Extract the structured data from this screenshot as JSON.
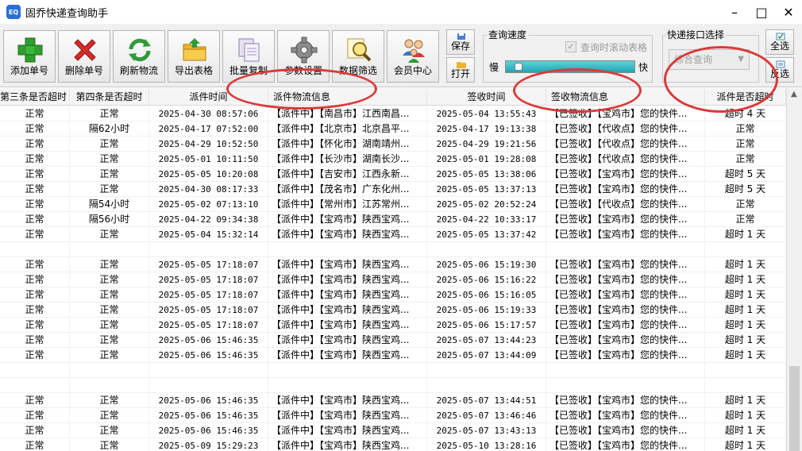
{
  "window": {
    "title": "固乔快递查询助手",
    "icon_text": "EQ"
  },
  "toolbar": {
    "buttons": [
      {
        "label": "添加单号",
        "icon": "plus-icon"
      },
      {
        "label": "删除单号",
        "icon": "delete-x-icon"
      },
      {
        "label": "刷新物流",
        "icon": "refresh-icon"
      },
      {
        "label": "导出表格",
        "icon": "folder-export-icon"
      },
      {
        "label": "批量复制",
        "icon": "copy-icon"
      },
      {
        "label": "参数设置",
        "icon": "gear-icon"
      },
      {
        "label": "数据筛选",
        "icon": "magnifier-icon"
      },
      {
        "label": "会员中心",
        "icon": "users-icon"
      }
    ],
    "save_label": "保存",
    "open_label": "打开",
    "speed_group": {
      "title": "查询速度",
      "scroll_label": "查询时滚动表格",
      "scroll_checked": true,
      "slow": "慢",
      "fast": "快",
      "speed_level": 0.05
    },
    "interface_group": {
      "title": "快递接口选择",
      "selected": "综合查询"
    },
    "select_all_label": "全选",
    "invert_label": "反选"
  },
  "table": {
    "columns": [
      "第三条是否超时",
      "第四条是否超时",
      "派件时间",
      "派件物流信息",
      "签收时间",
      "签收物流信息",
      "派件是否超时"
    ],
    "rows": [
      [
        "正常",
        "正常",
        "2025-04-30 08:57:06",
        "【派件中】【南昌市】江西南昌...",
        "2025-05-04 13:55:43",
        "【已签收】【宝鸡市】您的快件...",
        "超时 4 天"
      ],
      [
        "正常",
        "隔62小时",
        "2025-04-17 07:52:00",
        "【派件中】【北京市】北京昌平...",
        "2025-04-17 19:13:38",
        "【已签收】【代收点】您的快件...",
        "正常"
      ],
      [
        "正常",
        "正常",
        "2025-04-29 10:52:50",
        "【派件中】【怀化市】湖南靖州...",
        "2025-04-29 19:21:56",
        "【已签收】【代收点】您的快件...",
        "正常"
      ],
      [
        "正常",
        "正常",
        "2025-05-01 10:11:50",
        "【派件中】【长沙市】湖南长沙...",
        "2025-05-01 19:28:08",
        "【已签收】【代收点】您的快件...",
        "正常"
      ],
      [
        "正常",
        "正常",
        "2025-05-05 10:20:08",
        "【派件中】【吉安市】江西永新...",
        "2025-05-05 13:38:06",
        "【已签收】【宝鸡市】您的快件...",
        "超时 5 天"
      ],
      [
        "正常",
        "正常",
        "2025-04-30 08:17:33",
        "【派件中】【茂名市】广东化州...",
        "2025-05-05 13:37:13",
        "【已签收】【宝鸡市】您的快件...",
        "超时 5 天"
      ],
      [
        "正常",
        "隔54小时",
        "2025-05-02 07:13:10",
        "【派件中】【常州市】江苏常州...",
        "2025-05-02 20:52:24",
        "【已签收】【代收点】您的快件...",
        "正常"
      ],
      [
        "正常",
        "隔56小时",
        "2025-04-22 09:34:38",
        "【派件中】【宝鸡市】陕西宝鸡...",
        "2025-04-22 10:33:17",
        "【已签收】【宝鸡市】您的快件...",
        "正常"
      ],
      [
        "正常",
        "正常",
        "2025-05-04 15:32:14",
        "【派件中】【宝鸡市】陕西宝鸡...",
        "2025-05-05 13:37:42",
        "【已签收】【宝鸡市】您的快件...",
        "超时 1 天"
      ],
      [
        "",
        "",
        "",
        "",
        "",
        "",
        ""
      ],
      [
        "正常",
        "正常",
        "2025-05-05 17:18:07",
        "【派件中】【宝鸡市】陕西宝鸡...",
        "2025-05-06 15:19:30",
        "【已签收】【宝鸡市】您的快件...",
        "超时 1 天"
      ],
      [
        "正常",
        "正常",
        "2025-05-05 17:18:07",
        "【派件中】【宝鸡市】陕西宝鸡...",
        "2025-05-06 15:16:22",
        "【已签收】【宝鸡市】您的快件...",
        "超时 1 天"
      ],
      [
        "正常",
        "正常",
        "2025-05-05 17:18:07",
        "【派件中】【宝鸡市】陕西宝鸡...",
        "2025-05-06 15:16:05",
        "【已签收】【宝鸡市】您的快件...",
        "超时 1 天"
      ],
      [
        "正常",
        "正常",
        "2025-05-05 17:18:07",
        "【派件中】【宝鸡市】陕西宝鸡...",
        "2025-05-06 15:19:33",
        "【已签收】【宝鸡市】您的快件...",
        "超时 1 天"
      ],
      [
        "正常",
        "正常",
        "2025-05-05 17:18:07",
        "【派件中】【宝鸡市】陕西宝鸡...",
        "2025-05-06 15:17:57",
        "【已签收】【宝鸡市】您的快件...",
        "超时 1 天"
      ],
      [
        "正常",
        "正常",
        "2025-05-06 15:46:35",
        "【派件中】【宝鸡市】陕西宝鸡...",
        "2025-05-07 13:44:23",
        "【已签收】【宝鸡市】您的快件...",
        "超时 1 天"
      ],
      [
        "正常",
        "正常",
        "2025-05-06 15:46:35",
        "【派件中】【宝鸡市】陕西宝鸡...",
        "2025-05-07 13:44:09",
        "【已签收】【宝鸡市】您的快件...",
        "超时 1 天"
      ],
      [
        "",
        "",
        "",
        "",
        "",
        "",
        ""
      ],
      [
        "",
        "",
        "",
        "",
        "",
        "",
        ""
      ],
      [
        "正常",
        "正常",
        "2025-05-06 15:46:35",
        "【派件中】【宝鸡市】陕西宝鸡...",
        "2025-05-07 13:44:51",
        "【已签收】【宝鸡市】您的快件...",
        "超时 1 天"
      ],
      [
        "正常",
        "正常",
        "2025-05-06 15:46:35",
        "【派件中】【宝鸡市】陕西宝鸡...",
        "2025-05-07 13:46:46",
        "【已签收】【宝鸡市】您的快件...",
        "超时 1 天"
      ],
      [
        "正常",
        "正常",
        "2025-05-06 15:46:35",
        "【派件中】【宝鸡市】陕西宝鸡...",
        "2025-05-07 13:43:13",
        "【已签收】【宝鸡市】您的快件...",
        "超时 1 天"
      ],
      [
        "正常",
        "正常",
        "2025-05-09 15:29:23",
        "【派件中】【宝鸡市】陕西宝鸡...",
        "2025-05-10 13:28:16",
        "【已签收】【宝鸡市】您的快件...",
        "超时 1 天"
      ]
    ]
  },
  "colors": {
    "annotation": "#d93a3a",
    "progress": "#1fa7b4",
    "toolbar_bg": "#f0f0f0"
  }
}
